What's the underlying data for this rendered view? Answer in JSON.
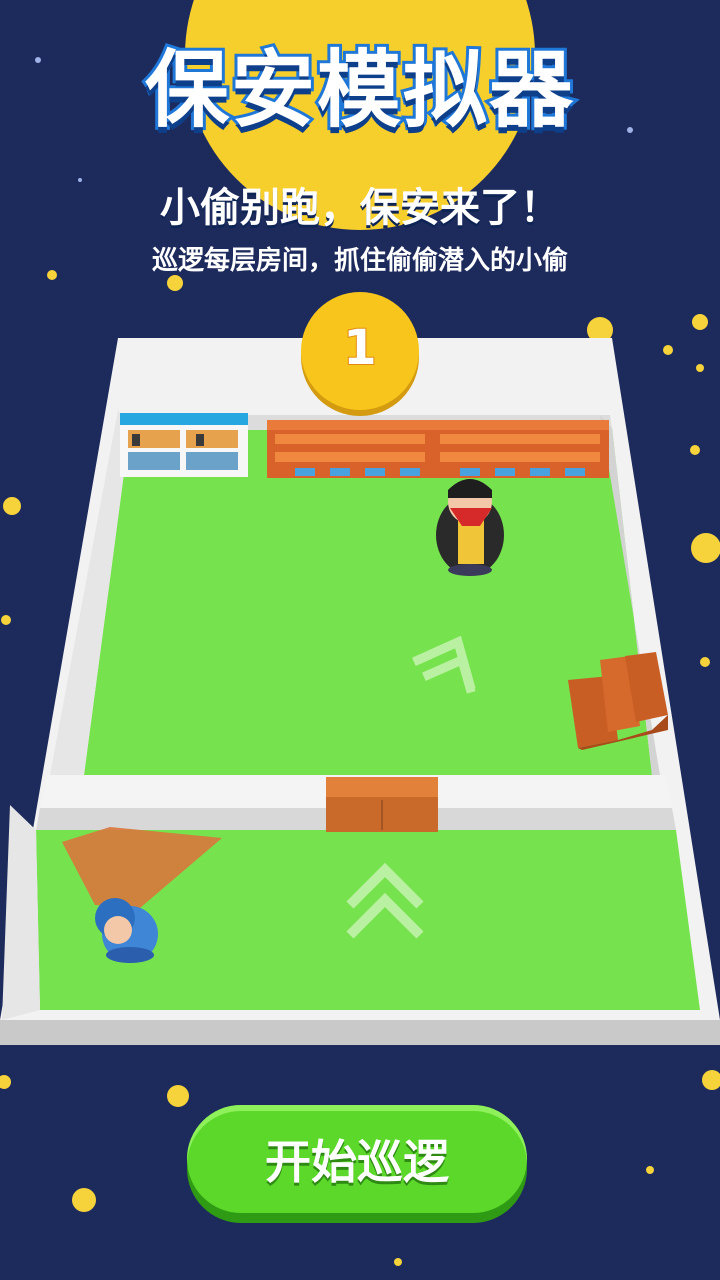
{
  "header": {
    "title": "保安模拟器",
    "subtitle": "小偷别跑，保安来了！",
    "tagline": "巡逻每层房间，抓住偷偷潜入的小偷"
  },
  "level": {
    "number": "1"
  },
  "actions": {
    "start_label": "开始巡逻"
  },
  "colors": {
    "background": "#1d2a5c",
    "moon": "#f7cf2d",
    "floor": "#76e34e",
    "wall": "#f1f1f1",
    "button": "#5bd82a"
  }
}
